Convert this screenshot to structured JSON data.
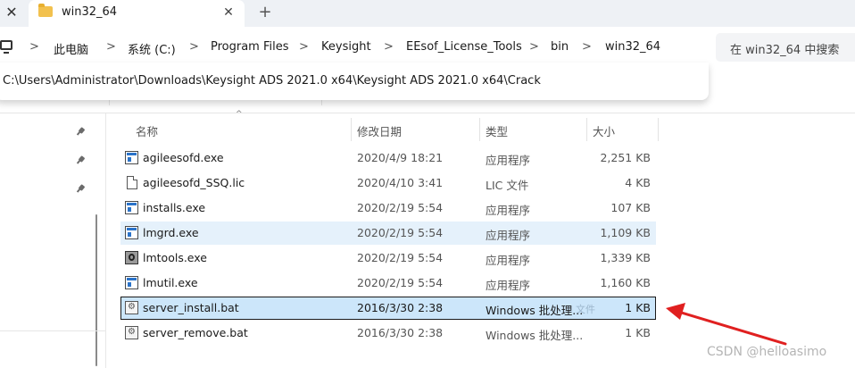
{
  "window": {
    "close_glyph": "✕",
    "tab_title": "win32_64",
    "tab_close_glyph": "✕",
    "new_tab_glyph": "+"
  },
  "breadcrumb": {
    "separator": ">",
    "items": [
      "此电脑",
      "系统 (C:)",
      "Program Files",
      "Keysight",
      "EEsof_License_Tools",
      "bin",
      "win32_64"
    ]
  },
  "search": {
    "placeholder": "在 win32_64 中搜索"
  },
  "path_popup": {
    "value": "C:\\Users\\Administrator\\Downloads\\Keysight ADS 2021.0 x64\\Keysight ADS 2021.0 x64\\Crack"
  },
  "columns": {
    "name": "名称",
    "modified": "修改日期",
    "type": "类型",
    "size": "大小"
  },
  "files": [
    {
      "name": "agileesofd.exe",
      "modified": "2020/4/9 18:21",
      "type": "应用程序",
      "size": "2,251 KB",
      "icon": "exe-icon",
      "state": "normal"
    },
    {
      "name": "agileesofd_SSQ.lic",
      "modified": "2020/4/10 3:41",
      "type": "LIC 文件",
      "size": "4 KB",
      "icon": "document-icon",
      "state": "normal"
    },
    {
      "name": "installs.exe",
      "modified": "2020/2/19 5:54",
      "type": "应用程序",
      "size": "107 KB",
      "icon": "exe-icon",
      "state": "normal"
    },
    {
      "name": "lmgrd.exe",
      "modified": "2020/2/19 5:54",
      "type": "应用程序",
      "size": "1,109 KB",
      "icon": "exe-icon",
      "state": "hover"
    },
    {
      "name": "lmtools.exe",
      "modified": "2020/2/19 5:54",
      "type": "应用程序",
      "size": "1,339 KB",
      "icon": "tool-icon",
      "state": "normal"
    },
    {
      "name": "lmutil.exe",
      "modified": "2020/2/19 5:54",
      "type": "应用程序",
      "size": "1,160 KB",
      "icon": "exe-icon",
      "state": "normal"
    },
    {
      "name": "server_install.bat",
      "modified": "2016/3/30 2:38",
      "type": "Windows 批处理...",
      "size": "1 KB",
      "icon": "batch-file-icon",
      "state": "selected"
    },
    {
      "name": "server_remove.bat",
      "modified": "2016/3/30 2:38",
      "type": "Windows 批处理...",
      "size": "1 KB",
      "icon": "batch-file-icon",
      "state": "normal"
    }
  ],
  "tooltip_ghost": "文件",
  "annotation": {
    "arrow_color": "#e02020"
  },
  "watermark": "CSDN @helloasimo",
  "colors": {
    "selection": "#cce6fa",
    "hover": "#e5f1fb",
    "folder": "#f2c14e"
  }
}
